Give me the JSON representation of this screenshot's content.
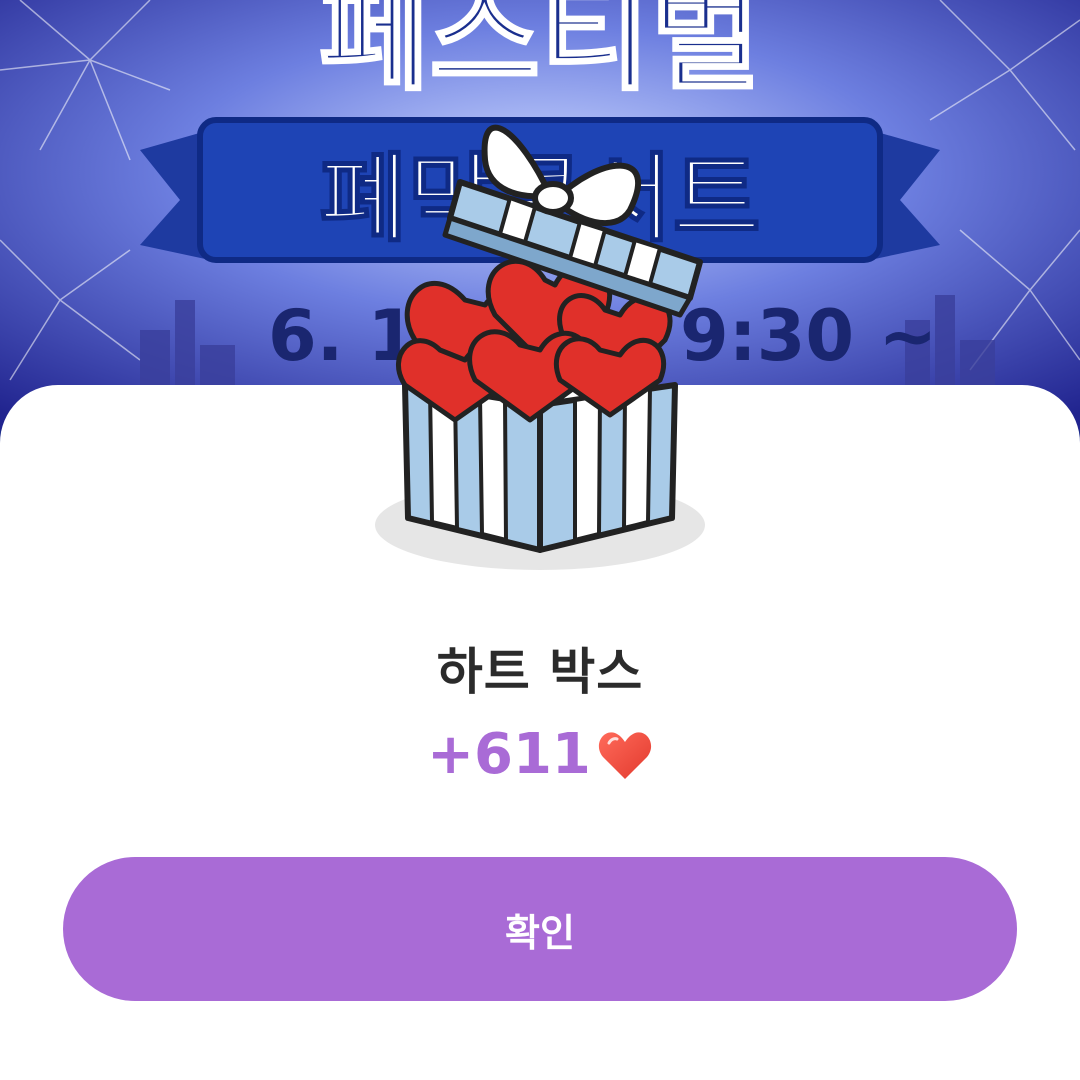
{
  "poster": {
    "title_line": "페스티벌",
    "banner_text": "폐막콘서트",
    "date_left": "6. 1",
    "date_right": "9:30 ~"
  },
  "reward": {
    "title": "하트 박스",
    "amount": "+611",
    "unit_icon": "heart-icon"
  },
  "actions": {
    "confirm_label": "확인"
  },
  "colors": {
    "accent": "#a96bd6",
    "poster_blue": "#1b3a9e",
    "box_blue": "#a9cbe8",
    "heart_red": "#e0302a"
  }
}
